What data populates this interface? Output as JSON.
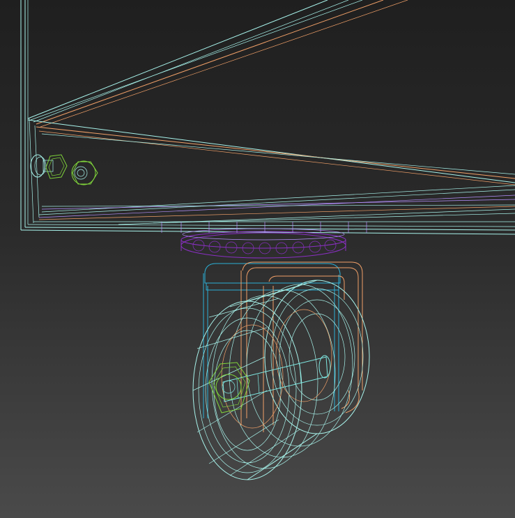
{
  "viewport": {
    "shading": "wireframe",
    "background_top": "#1f1f1f",
    "background_bottom": "#4a4a4a"
  },
  "colors": {
    "cabinet_outline": "#a8f4ec",
    "cabinet_inner": "#f1a068",
    "leveler_plate": "#8a2fc4",
    "caster_bracket": "#2bb0d6",
    "caster_housing": "#f1a068",
    "wheel_mesh": "#a8f4ec",
    "bolt_nut": "#7fd33a",
    "hardware_highlight": "#b691ff"
  },
  "objects": [
    "cabinet-frame-wireframe",
    "side-bolt-assembly",
    "swivel-plate",
    "caster-bracket",
    "caster-wheel",
    "axle-bolt",
    "axle-nut"
  ]
}
